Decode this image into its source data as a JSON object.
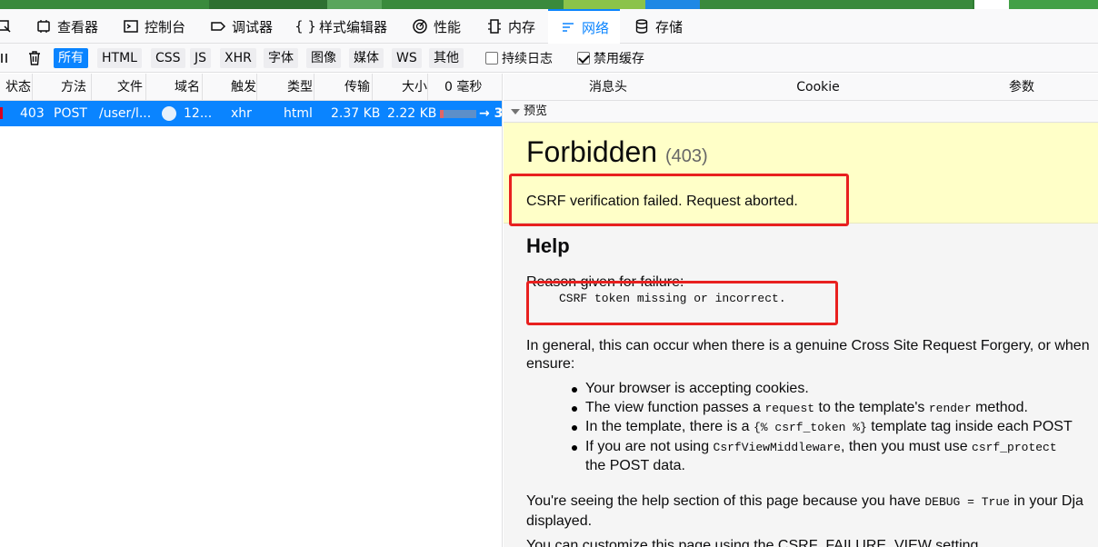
{
  "tabs": [
    {
      "label": "查看器",
      "icon": "inspector-icon"
    },
    {
      "label": "控制台",
      "icon": "console-icon"
    },
    {
      "label": "调试器",
      "icon": "debugger-icon"
    },
    {
      "label": "样式编辑器",
      "icon": "style-editor-icon"
    },
    {
      "label": "性能",
      "icon": "performance-icon"
    },
    {
      "label": "内存",
      "icon": "memory-icon"
    },
    {
      "label": "网络",
      "icon": "network-icon",
      "selected": true
    },
    {
      "label": "存储",
      "icon": "storage-icon"
    }
  ],
  "filters": [
    "所有",
    "HTML",
    "CSS",
    "JS",
    "XHR",
    "字体",
    "图像",
    "媒体",
    "WS",
    "其他"
  ],
  "checkboxes": [
    {
      "label": "持续日志",
      "checked": false
    },
    {
      "label": "禁用缓存",
      "checked": true
    }
  ],
  "columns": [
    "状态",
    "方法",
    "文件",
    "域名",
    "触发",
    "类型",
    "传输",
    "大小",
    "0 毫秒"
  ],
  "request": {
    "status": "403",
    "method": "POST",
    "file": "/user/l...",
    "domain": "12...",
    "cause": "xhr",
    "type": "html",
    "transferred": "2.37 KB",
    "size": "2.22 KB",
    "timing": "→ 3"
  },
  "detail_tabs": [
    "消息头",
    "Cookie",
    "参数"
  ],
  "preview_label": "预览",
  "page": {
    "title": "Forbidden",
    "code": "(403)",
    "message": "CSRF verification failed. Request aborted.",
    "help_heading": "Help",
    "reason_label": "Reason given for failure:",
    "reason": "CSRF token missing or incorrect.",
    "general": "In general, this can occur when there is a genuine Cross Site Request Forgery, or when ensure:",
    "bullets": [
      {
        "text": "Your browser is accepting cookies."
      },
      {
        "pre": "The view function passes a ",
        "code": "request",
        "post": " to the template's ",
        "code2": "render",
        "post2": " method."
      },
      {
        "pre": "In the template, there is a ",
        "code": "{% csrf_token %}",
        "post": " template tag inside each POST"
      },
      {
        "pre": "If you are not using ",
        "code": "CsrfViewMiddleware",
        "post": ", then you must use ",
        "code2": "csrf_protect",
        "post2": ""
      },
      {
        "text": "the POST data.",
        "continuation": true
      }
    ],
    "debug_pre": "You're seeing the help section of this page because you have ",
    "debug_code": "DEBUG = True",
    "debug_post": " in your Dja",
    "debug_line2": "displayed.",
    "customize": "You can customize this page using the CSRF_FAILURE_VIEW setting."
  },
  "colors": {
    "accent": "#0a84ff",
    "summary_bg": "#ffffc8",
    "help_bg": "#f5f5f5",
    "highlight_red": "#e8201f"
  }
}
